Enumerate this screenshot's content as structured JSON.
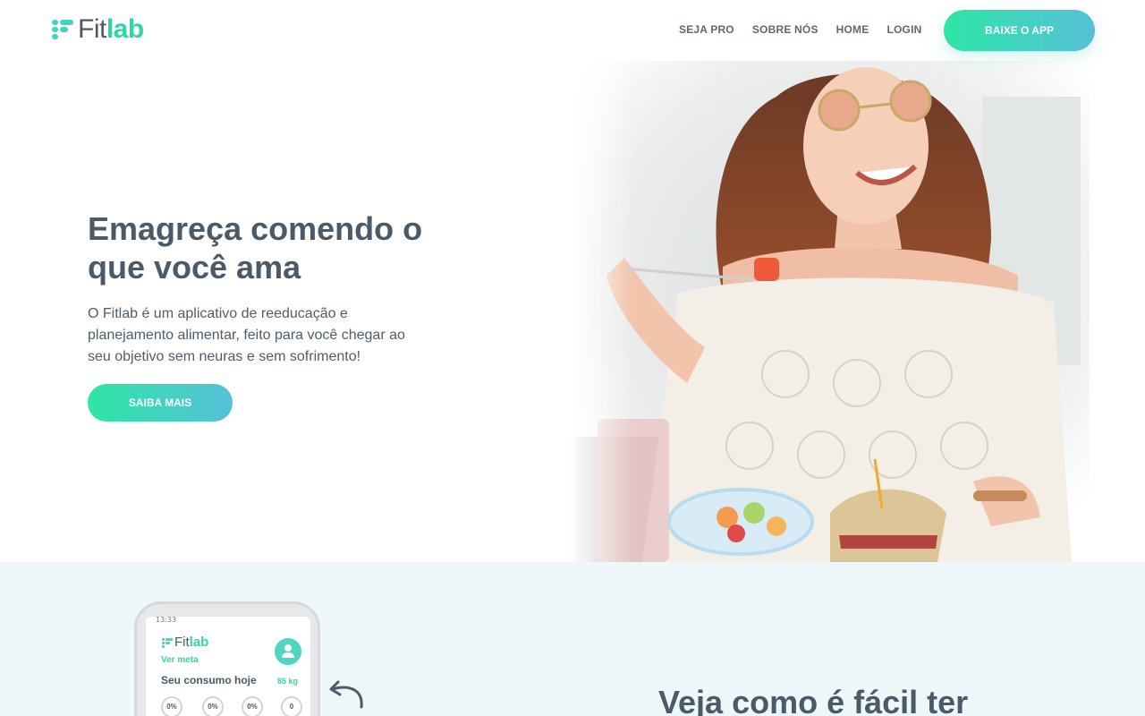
{
  "brand": {
    "name_part1": "Fit",
    "name_part2": "lab"
  },
  "nav": {
    "items": [
      {
        "label": "SEJA PRO"
      },
      {
        "label": "SOBRE NÓS"
      },
      {
        "label": "HOME"
      },
      {
        "label": "LOGIN"
      }
    ],
    "cta_label": "BAIXE O APP"
  },
  "hero": {
    "title": "Emagreça comendo o que você ama",
    "description": "O Fitlab é um aplicativo de reeducação e planejamento alimentar, feito para você chegar ao seu objetivo sem neuras e sem sofrimento!",
    "cta_label": "SAIBA MAIS"
  },
  "phone": {
    "status_time": "13:33",
    "logo_part1": "Fit",
    "logo_part2": "lab",
    "ver_meta": "Ver meta",
    "consumo_label": "Seu consumo hoje",
    "weight": "85 kg",
    "rings": [
      "0%",
      "0%",
      "0%",
      "0"
    ]
  },
  "section2": {
    "title": "Veja como é fácil ter"
  },
  "colors": {
    "accent_start": "#2ee6a6",
    "accent_end": "#55c0d8",
    "text_dark": "#4a5a68",
    "section_bg": "#eef7f9"
  }
}
